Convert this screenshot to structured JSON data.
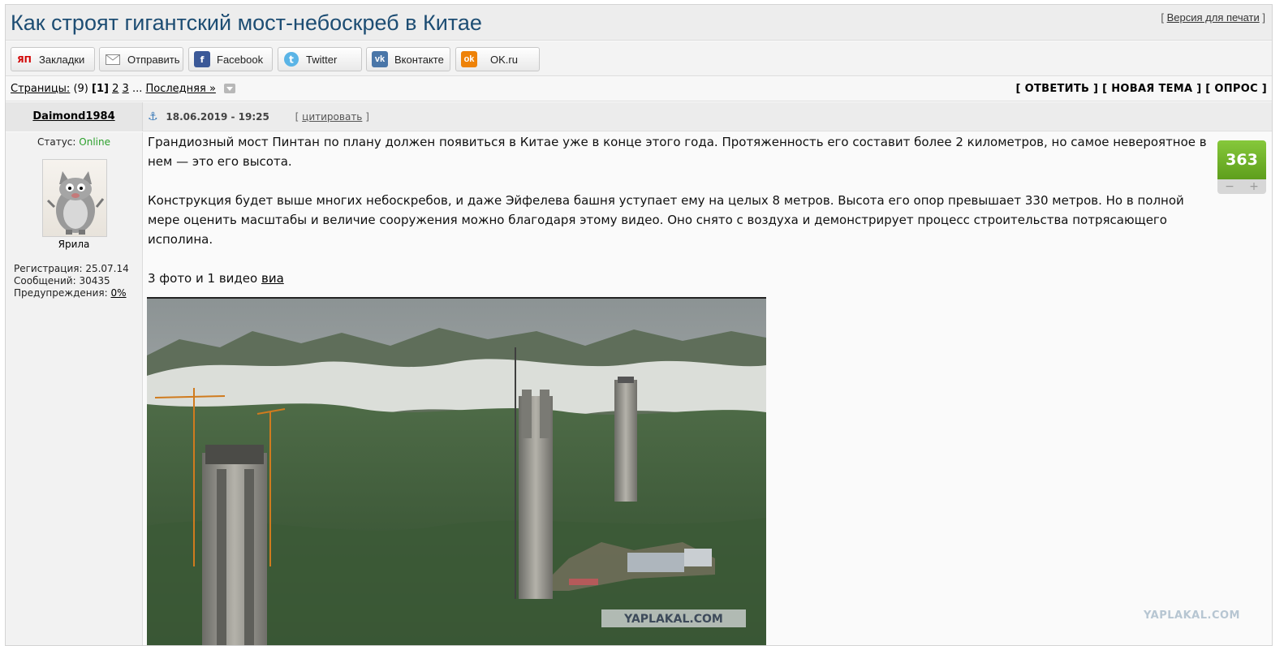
{
  "title": "Как строят гигантский мост-небоскреб в Китае",
  "print_link": "Версия для печати",
  "share": [
    {
      "label": "Закладки",
      "icon": "yap-bookmark-icon",
      "glyph": "ЯП"
    },
    {
      "label": "Отправить",
      "icon": "mail-icon",
      "glyph": "✉"
    },
    {
      "label": "Facebook",
      "icon": "facebook-icon",
      "glyph": "f"
    },
    {
      "label": "Twitter",
      "icon": "twitter-icon",
      "glyph": "t"
    },
    {
      "label": "Вконтакте",
      "icon": "vk-icon",
      "glyph": "vk"
    },
    {
      "label": "OK.ru",
      "icon": "ok-icon",
      "glyph": "ok"
    }
  ],
  "nav": {
    "pages_label": "Страницы:",
    "pages_count": "(9)",
    "current_page": "1",
    "page_2": "2",
    "page_3": "3",
    "ellipsis": "...",
    "last_page": "Последняя »",
    "reply": "ОТВЕТИТЬ",
    "new_topic": "НОВАЯ ТЕМА",
    "poll": "ОПРОС"
  },
  "post": {
    "author": "Daimond1984",
    "date": "18.06.2019 - 19:25",
    "quote": "цитировать",
    "status_label": "Статус:",
    "status_value": "Online",
    "avatar_caption": "Ярила",
    "reg": "Регистрация: 25.07.14",
    "messages": "Сообщений: 30435",
    "warnings_label": "Предупреждения:",
    "warnings_value": "0%",
    "paragraph1": "Грандиозный мост Пинтан по плану должен появиться в Китае уже в конце этого года. Протяженность его составит более 2 километров, но самое невероятное в нем — это его высота.",
    "paragraph2": "Конструкция будет выше многих небоскребов, и даже Эйфелева башня уступает ему на целых 8 метров. Высота его опор превышает 330 метров. Но в полной мере оценить масштабы и величие сооружения можно благодаря этому видео. Оно снято с воздуха и демонстрирует процесс строительства потрясающего исполина.",
    "media_text": "3 фото и 1 видео",
    "via_link": "виа",
    "rating": "363",
    "minus": "−",
    "plus": "+"
  },
  "watermark_photo": "YAPLAKAL.COM",
  "watermark_page": "YAPLAKAL.COM",
  "colors": {
    "title": "#1d4d73",
    "online": "#2ca02c",
    "rating": "#6fb02a"
  }
}
